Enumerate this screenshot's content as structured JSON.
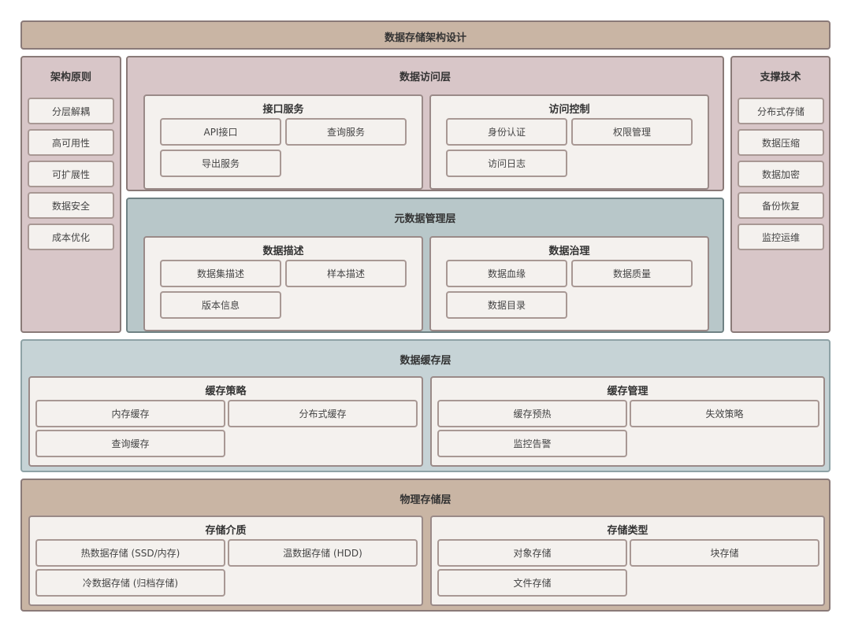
{
  "title": "数据存储架构设计",
  "principles": {
    "title": "架构原则",
    "items": [
      "分层解耦",
      "高可用性",
      "可扩展性",
      "数据安全",
      "成本优化"
    ]
  },
  "support": {
    "title": "支撑技术",
    "items": [
      "分布式存储",
      "数据压缩",
      "数据加密",
      "备份恢复",
      "监控运维"
    ]
  },
  "access_layer": {
    "title": "数据访问层",
    "interface": {
      "title": "接口服务",
      "items": [
        "API接口",
        "查询服务",
        "导出服务"
      ]
    },
    "control": {
      "title": "访问控制",
      "items": [
        "身份认证",
        "权限管理",
        "访问日志"
      ]
    }
  },
  "metadata_layer": {
    "title": "元数据管理层",
    "description": {
      "title": "数据描述",
      "items": [
        "数据集描述",
        "样本描述",
        "版本信息"
      ]
    },
    "governance": {
      "title": "数据治理",
      "items": [
        "数据血缘",
        "数据质量",
        "数据目录"
      ]
    }
  },
  "cache_layer": {
    "title": "数据缓存层",
    "strategy": {
      "title": "缓存策略",
      "items": [
        "内存缓存",
        "分布式缓存",
        "查询缓存"
      ]
    },
    "management": {
      "title": "缓存管理",
      "items": [
        "缓存预热",
        "失效策略",
        "监控告警"
      ]
    }
  },
  "physical_layer": {
    "title": "物理存储层",
    "media": {
      "title": "存储介质",
      "items": [
        "热数据存储 (SSD/内存)",
        "温数据存储 (HDD)",
        "冷数据存储 (归档存储)"
      ]
    },
    "types": {
      "title": "存储类型",
      "items": [
        "对象存储",
        "块存储",
        "文件存储"
      ]
    }
  },
  "colors": {
    "header": "#c9b5a4",
    "side": "#d8c6c8",
    "access": "#d8c6c8",
    "metadata": "#b8c7c9",
    "cache": "#c6d3d6",
    "physical": "#c9b5a4",
    "box": "#f4f1ee"
  }
}
